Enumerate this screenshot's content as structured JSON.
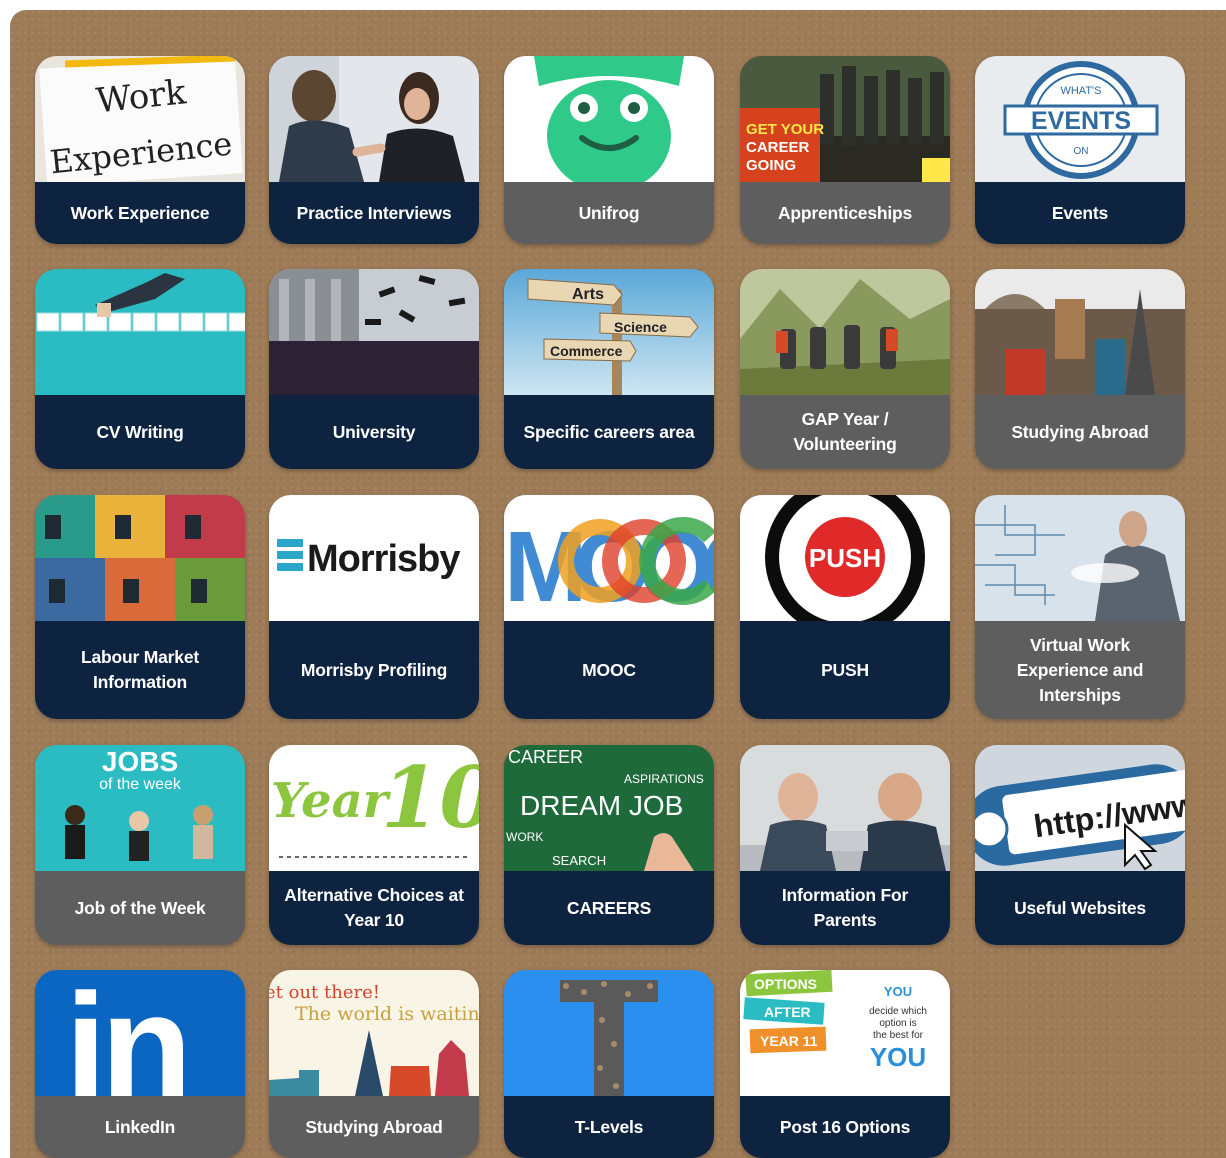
{
  "tiles": [
    {
      "label": "Work Experience",
      "theme": "navy",
      "image": "work-experience-image",
      "image_text": [
        "Work",
        "Experience"
      ]
    },
    {
      "label": "Practice Interviews",
      "theme": "navy",
      "image": "handshake-interview-image"
    },
    {
      "label": "Unifrog",
      "theme": "grey",
      "image": "unifrog-frog-logo-image"
    },
    {
      "label": "Apprenticeships",
      "theme": "grey",
      "image": "apprenticeships-poster-image",
      "image_text": [
        "GET YOUR",
        "CAREER",
        "GOING"
      ]
    },
    {
      "label": "Events",
      "theme": "navy",
      "image": "events-stamp-image",
      "image_text": [
        "WHAT'S",
        "EVENTS",
        "ON"
      ]
    },
    {
      "label": "CV Writing",
      "theme": "navy",
      "image": "cv-writing-image"
    },
    {
      "label": "University",
      "theme": "navy",
      "image": "graduation-image"
    },
    {
      "label": "Specific careers area",
      "theme": "navy",
      "image": "signpost-image",
      "image_text": [
        "Arts",
        "Science",
        "Commerce"
      ]
    },
    {
      "label": "GAP Year / Volunteering",
      "theme": "grey",
      "image": "hikers-image"
    },
    {
      "label": "Studying Abroad",
      "theme": "grey",
      "image": "world-landmarks-image"
    },
    {
      "label": "Labour Market Information",
      "theme": "navy",
      "image": "shopfronts-image"
    },
    {
      "label": "Morrisby Profiling",
      "theme": "navy",
      "image": "morrisby-logo-image",
      "image_text": [
        "Morrisby"
      ]
    },
    {
      "label": "MOOC",
      "theme": "navy",
      "image": "mooc-logo-image",
      "image_text": [
        "MOOC"
      ]
    },
    {
      "label": "PUSH",
      "theme": "navy",
      "image": "push-logo-image",
      "image_text": [
        "PUSH"
      ]
    },
    {
      "label": "Virtual Work Experience and Interships",
      "theme": "grey",
      "image": "virtual-tech-image"
    },
    {
      "label": "Job of the Week",
      "theme": "grey",
      "image": "jobs-of-the-week-image",
      "image_text": [
        "JOBS",
        "of the week"
      ]
    },
    {
      "label": "Alternative Choices at Year 10",
      "theme": "navy",
      "image": "year-10-image",
      "image_text": [
        "Year",
        "10"
      ]
    },
    {
      "label": "CAREERS",
      "theme": "navy",
      "image": "chalkboard-dream-job-image",
      "image_text": [
        "CAREER",
        "ASPIRATIONS",
        "DREAM JOB",
        "WORK",
        "SEARCH"
      ]
    },
    {
      "label": "Information For Parents",
      "theme": "navy",
      "image": "parents-laptop-image"
    },
    {
      "label": "Useful Websites",
      "theme": "navy",
      "image": "url-bar-image",
      "image_text": [
        "http://www"
      ]
    },
    {
      "label": "LinkedIn",
      "theme": "grey",
      "image": "linkedin-logo-image",
      "image_text": [
        "in"
      ]
    },
    {
      "label": "Studying Abroad",
      "theme": "grey",
      "image": "world-waiting-image",
      "image_text": [
        "et out there!",
        "The world is waiting."
      ]
    },
    {
      "label": "T-Levels",
      "theme": "navy",
      "image": "t-levels-image"
    },
    {
      "label": "Post 16 Options",
      "theme": "navy",
      "image": "post-16-options-image",
      "image_text": [
        "OPTIONS",
        "AFTER",
        "YEAR 11",
        "YOU",
        "decide which",
        "option is",
        "the best for",
        "YOU"
      ]
    }
  ]
}
